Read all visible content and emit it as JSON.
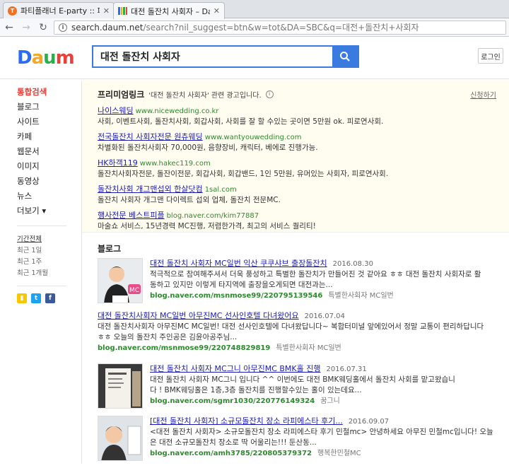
{
  "browser": {
    "tabs": [
      {
        "title": "파티플래너 E-party :: 파",
        "active": false
      },
      {
        "title": "대전 돌잔치 사회자 – Da",
        "active": true
      }
    ],
    "url_host": "search.daum.net",
    "url_path": "/search?nil_suggest=btn&w=tot&DA=SBC&q=대전+돌잔치+사회자"
  },
  "header": {
    "logo_letters": [
      "D",
      "a",
      "u",
      "m"
    ],
    "logo_colors": [
      "#2a6df4",
      "#f5a623",
      "#2ab04a",
      "#e8403b"
    ],
    "search_value": "대전 돌잔치 사회자",
    "login_label": "로그인"
  },
  "sidebar": {
    "items": [
      {
        "label": "통합검색",
        "active": true
      },
      {
        "label": "블로그"
      },
      {
        "label": "사이트"
      },
      {
        "label": "카페"
      },
      {
        "label": "웹문서"
      },
      {
        "label": "이미지"
      },
      {
        "label": "동영상"
      },
      {
        "label": "뉴스"
      },
      {
        "label": "더보기 ▾"
      }
    ],
    "period_head": "기간전체",
    "period_options": [
      "최근 1일",
      "최근 1주",
      "최근 1개월"
    ]
  },
  "premium": {
    "title": "프리미엄링크",
    "desc": "'대전 돌잔치 사회자' 관련 광고입니다.",
    "apply": "신청하기",
    "ads": [
      {
        "title": "나이스웨딩",
        "url": "www.nicewedding.co.kr",
        "desc": "사회, 이벤트사회, 돌잔치사회, 회갑사회, 사회를 잘 할 수있는 곳이면 5만원 ok. 피로연사회."
      },
      {
        "title": "전국돌잔치 사회자전문 원츄웨딩",
        "url": "www.wantyouwedding.com",
        "desc": "차별화된 돌잔치사회자 70,000원, 음향장비, 캐릭터, 베에로 진행가능."
      },
      {
        "title": "HK하객119",
        "url": "www.hakec119.com",
        "desc": "돌잔치사회자전문, 돌잔이전문, 회갑사회, 회갑밴드, 1인 5만원, 유머있는 사회자, 피로연사회."
      },
      {
        "title": "돌잔치사회 개그맨섭외 한살닷컴",
        "url": "1sal.com",
        "desc": "돌잔치 사회자 개그맨 다이렉트 섭외 업체, 돌잔치 전문MC."
      },
      {
        "title": "행사전문 베스트피플",
        "url": "blog.naver.com/kim77887",
        "desc": "마술쇼 서비스, 15년경력 MC진행, 저렴한가격, 최고의 서비스 퀄리티!"
      }
    ]
  },
  "blog": {
    "label": "블로그",
    "posts": [
      {
        "title": "대전 돌잔치 사회자 MC일번 익산 쿠쿠샤브 출장돌잔치",
        "date": "2016.08.30",
        "snip1": "적극적으로 참여해주셔서 더욱 풍성하고 특별한 돌잔치가 만들어진 것 같아요 ㅎㅎ 대전 돌잔치 사회자로 활",
        "snip2": "동하고 있지만 이렇게 타지역에 출장을오게되면 대전과는...",
        "url": "blog.naver.com/msnmose99/220795139546",
        "blog": "특별한사회자 MC일번",
        "thumb": "person1"
      },
      {
        "title": "대전 돌잔치사회자 MC일번 아무진MC 선사인호텔 다녀왔어요",
        "date": "2016.07.04",
        "snip1": "대전 돌잔치사회자 아무진MC MC일번! 대전 선사인호텔에 다녀왔답니다~ 복합터미널 앞에있어서 정말 교통이 편리하답니다",
        "snip2": "ㅎㅎ 오늘의 돌잔치 주인공은 김윤아공주님...",
        "url": "blog.naver.com/msnmose99/220748829819",
        "blog": "특별한사회자 MC일번",
        "thumb": ""
      },
      {
        "title": "대전 돌잔치 사회자 MC그니 아무진MC BMK홀 진행",
        "date": "2016.07.31",
        "snip1": "대전 돌잔치 사회자 MC그니 입니다 ^^ 이번에도 대전 BMK웨딩홀에서 돌잔치 사회를 맡고왔습니",
        "snip2": "다 ! BMK웨딩홀은 1층,3층 돌잔치를 진행할수있는 홀이 있는데요...",
        "url": "blog.naver.com/sgmr1030/220776149324",
        "blog": "꿈그니",
        "thumb": "person2"
      },
      {
        "title": "[대전 돌잔치 사회자] 소규모돌잔치 장소 라피에스타 후기...",
        "date": "2016.09.07",
        "snip1": "<대전 돌잔치 사회자> 소규모돌잔치 장소 라피에스타 후기 민철mc> 안녕하세요 아무진 민철mc입니다! 오늘",
        "snip2": "은 대전 소규모돌잔치 장소로 딱 어울리는!!! 둔산동...",
        "url": "blog.naver.com/amh3785/220805379372",
        "blog": "행복한민철MC",
        "thumb": "person3"
      }
    ]
  }
}
